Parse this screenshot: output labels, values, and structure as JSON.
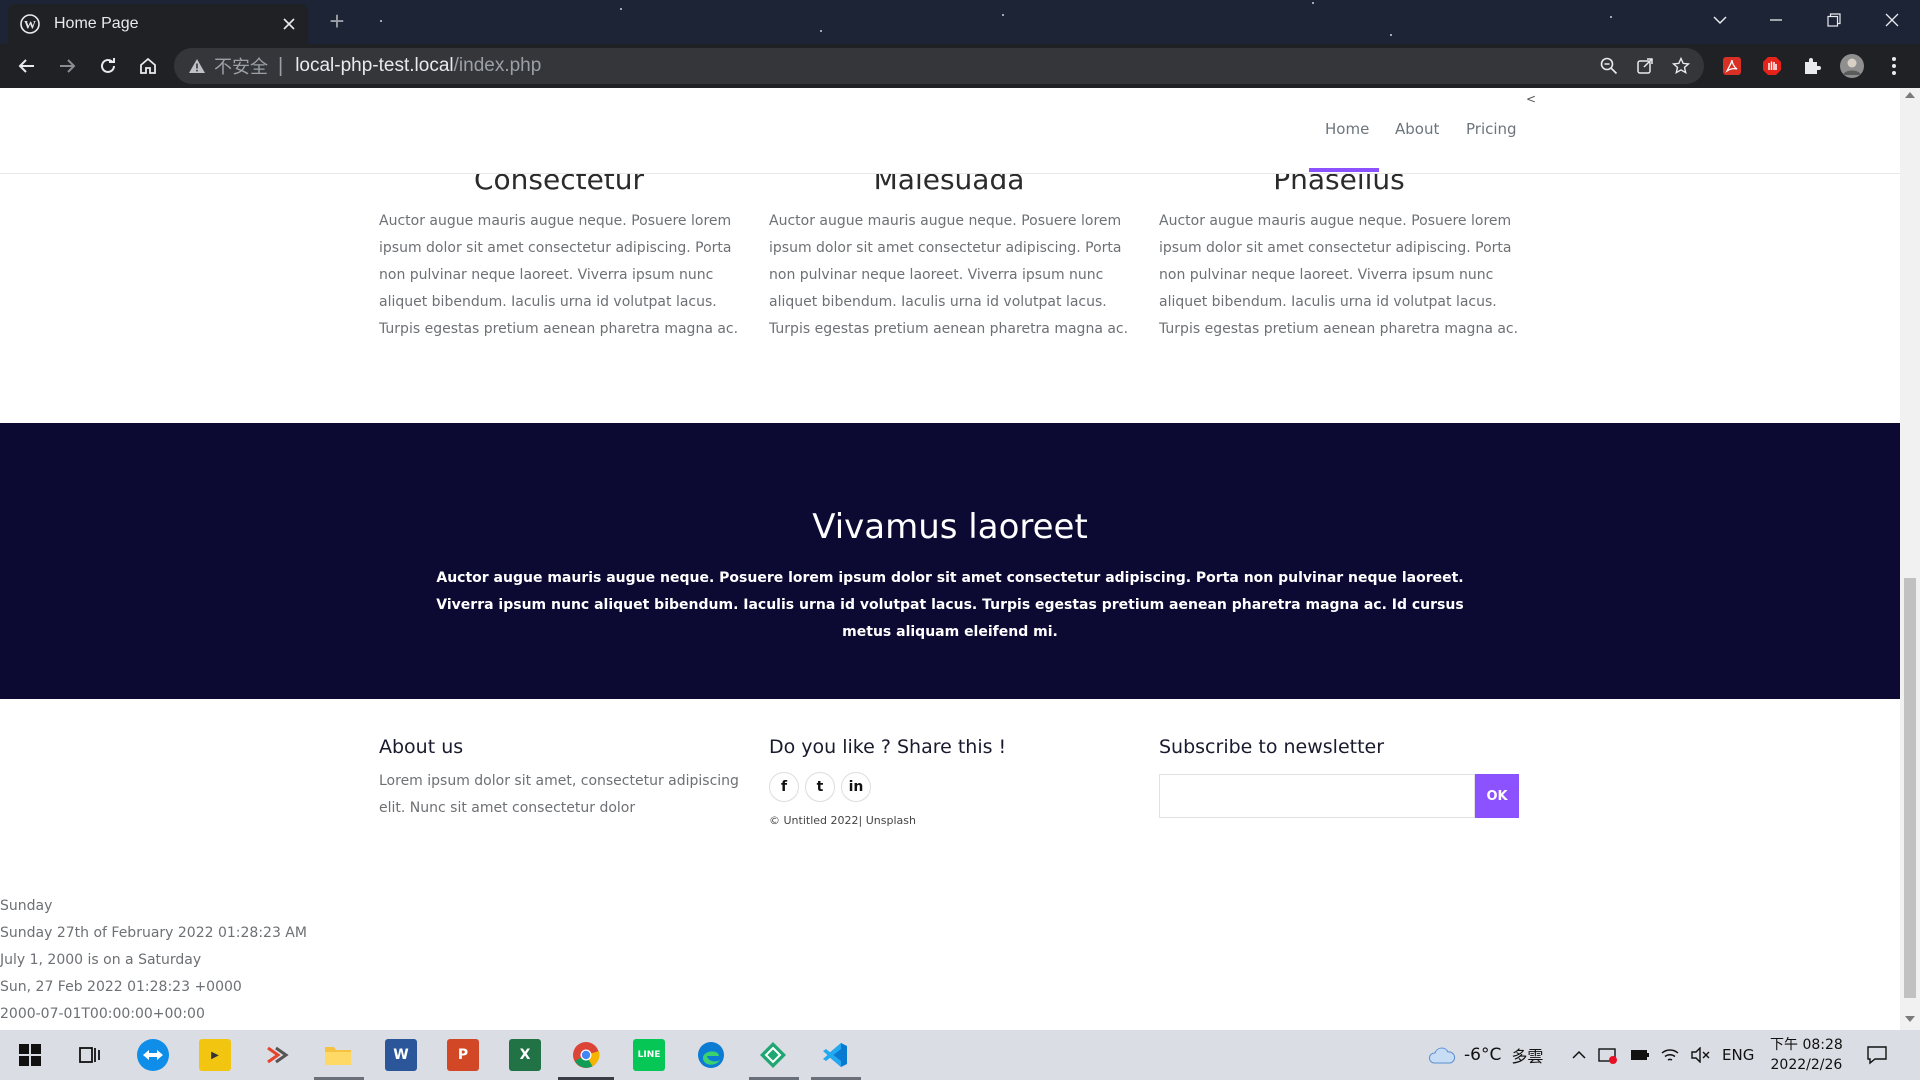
{
  "browser": {
    "tab_title": "Home Page",
    "new_tab": "+",
    "insecure_label": "不安全",
    "url_host": "local-php-test.local",
    "url_path": "/index.php"
  },
  "nav": {
    "items": [
      {
        "label": "Home"
      },
      {
        "label": "About"
      },
      {
        "label": "Pricing"
      }
    ],
    "caret": "<"
  },
  "features": [
    {
      "title": "Consectetur",
      "text": "Auctor augue mauris augue neque. Posuere lorem ipsum dolor sit amet consectetur adipiscing. Porta non pulvinar neque laoreet. Viverra ipsum nunc aliquet bibendum. Iaculis urna id volutpat lacus. Turpis egestas pretium aenean pharetra magna ac."
    },
    {
      "title": "Malesuada",
      "text": "Auctor augue mauris augue neque. Posuere lorem ipsum dolor sit amet consectetur adipiscing. Porta non pulvinar neque laoreet. Viverra ipsum nunc aliquet bibendum. Iaculis urna id volutpat lacus. Turpis egestas pretium aenean pharetra magna ac."
    },
    {
      "title": "Phasellus",
      "text": "Auctor augue mauris augue neque. Posuere lorem ipsum dolor sit amet consectetur adipiscing. Porta non pulvinar neque laoreet. Viverra ipsum nunc aliquet bibendum. Iaculis urna id volutpat lacus. Turpis egestas pretium aenean pharetra magna ac."
    }
  ],
  "band": {
    "title": "Vivamus laoreet",
    "text": "Auctor augue mauris augue neque. Posuere lorem ipsum dolor sit amet consectetur adipiscing. Porta non pulvinar neque laoreet. Viverra ipsum nunc aliquet bibendum. Iaculis urna id volutpat lacus. Turpis egestas pretium aenean pharetra magna ac. Id cursus metus aliquam eleifend mi."
  },
  "footer": {
    "about_title": "About us",
    "about_text": "Lorem ipsum dolor sit amet, consectetur adipiscing elit. Nunc sit amet consectetur dolor",
    "share_title": "Do you like ? Share this !",
    "social": [
      {
        "label": "f",
        "icon": "facebook-icon"
      },
      {
        "label": "t",
        "icon": "twitter-icon"
      },
      {
        "label": "in",
        "icon": "linkedin-icon"
      }
    ],
    "copyright": "© Untitled 2022| Unsplash",
    "newsletter_title": "Subscribe to newsletter",
    "newsletter_button": "OK"
  },
  "php_output": [
    "Sunday",
    "Sunday 27th of February 2022 01:28:23 AM",
    "July 1, 2000 is on a Saturday",
    "Sun, 27 Feb 2022 01:28:23 +0000",
    "2000-07-01T00:00:00+00:00"
  ],
  "taskbar": {
    "weather": "-6°C",
    "weather_desc": "多雲",
    "language": "ENG",
    "time": "下午 08:28",
    "date": "2022/2/26"
  },
  "colors": {
    "accent": "#8c52ff",
    "band_bg": "#0c0a33",
    "chrome_bg": "#202124"
  }
}
